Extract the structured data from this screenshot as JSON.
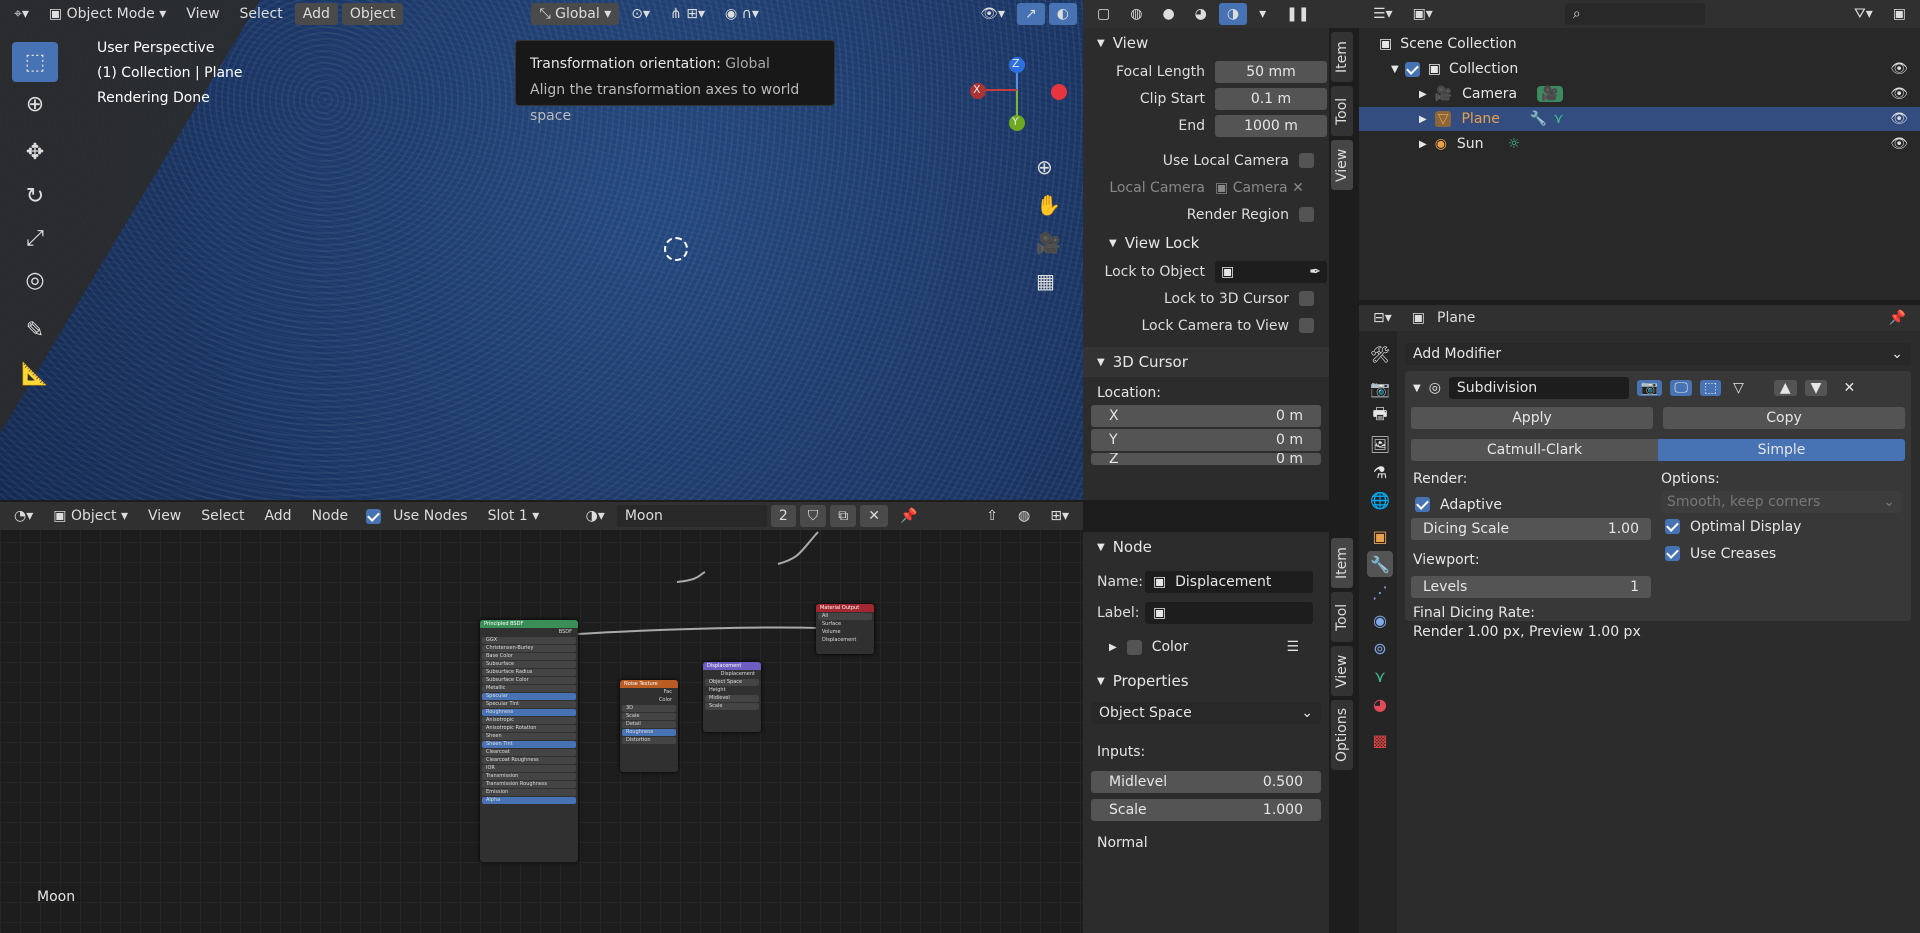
{
  "viewport": {
    "mode": "Object Mode",
    "menu": [
      "View",
      "Select",
      "Add",
      "Object"
    ],
    "orientation": "Global",
    "overlay": [
      "User Perspective",
      "(1) Collection | Plane",
      "Rendering Done"
    ],
    "tooltip": {
      "title": "Transformation orientation:",
      "value": "Global",
      "desc": "Align the transformation axes to world space"
    },
    "gizmo": {
      "z": "Z",
      "x": "X",
      "y": "Y"
    }
  },
  "npanel": {
    "tabs": [
      "Item",
      "Tool",
      "View"
    ],
    "view": {
      "title": "View",
      "focal_label": "Focal Length",
      "focal": "50 mm",
      "clip_start_label": "Clip Start",
      "clip_start": "0.1 m",
      "end_label": "End",
      "end": "1000 m",
      "use_local_camera": "Use Local Camera",
      "local_camera_label": "Local Camera",
      "local_camera": "Camera",
      "render_region": "Render Region"
    },
    "view_lock": {
      "title": "View Lock",
      "lock_object": "Lock to Object",
      "lock_cursor": "Lock to 3D Cursor",
      "lock_camera": "Lock Camera to View"
    },
    "cursor": {
      "title": "3D Cursor",
      "location": "Location:",
      "x_label": "X",
      "x": "0 m",
      "y_label": "Y",
      "y": "0 m",
      "z_label": "Z",
      "z": "0 m"
    }
  },
  "node_editor": {
    "header": {
      "type": "Object",
      "menu": [
        "View",
        "Select",
        "Add",
        "Node"
      ],
      "use_nodes": "Use Nodes",
      "slot": "Slot 1",
      "material": "Moon",
      "users": "2"
    },
    "footer_label": "Moon",
    "nodes": {
      "bsdf": "Principled BSDF",
      "output": "Material Output",
      "noise": "Noise Texture",
      "disp": "Displacement"
    }
  },
  "node_panel": {
    "tabs": [
      "Item",
      "Tool",
      "View",
      "Options"
    ],
    "node": {
      "title": "Node",
      "name_label": "Name:",
      "name": "Displacement",
      "label_label": "Label:",
      "color": "Color"
    },
    "properties": {
      "title": "Properties",
      "space": "Object Space",
      "inputs": "Inputs:",
      "midlevel_label": "Midlevel",
      "midlevel": "0.500",
      "scale_label": "Scale",
      "scale": "1.000",
      "normal": "Normal"
    }
  },
  "outliner": {
    "root": "Scene Collection",
    "items": [
      {
        "name": "Collection"
      },
      {
        "name": "Camera"
      },
      {
        "name": "Plane"
      },
      {
        "name": "Sun"
      }
    ]
  },
  "properties": {
    "object": "Plane",
    "add_modifier": "Add Modifier",
    "modifier_name": "Subdivision",
    "apply": "Apply",
    "copy": "Copy",
    "catmull": "Catmull-Clark",
    "simple": "Simple",
    "render": "Render:",
    "adaptive": "Adaptive",
    "dicing_label": "Dicing Scale",
    "dicing": "1.00",
    "options": "Options:",
    "smooth": "Smooth, keep corners",
    "optimal": "Optimal Display",
    "creases": "Use Creases",
    "viewport": "Viewport:",
    "levels_label": "Levels",
    "levels": "1",
    "final": "Final Dicing Rate:",
    "final_val": "Render 1.00 px, Preview 1.00 px"
  }
}
